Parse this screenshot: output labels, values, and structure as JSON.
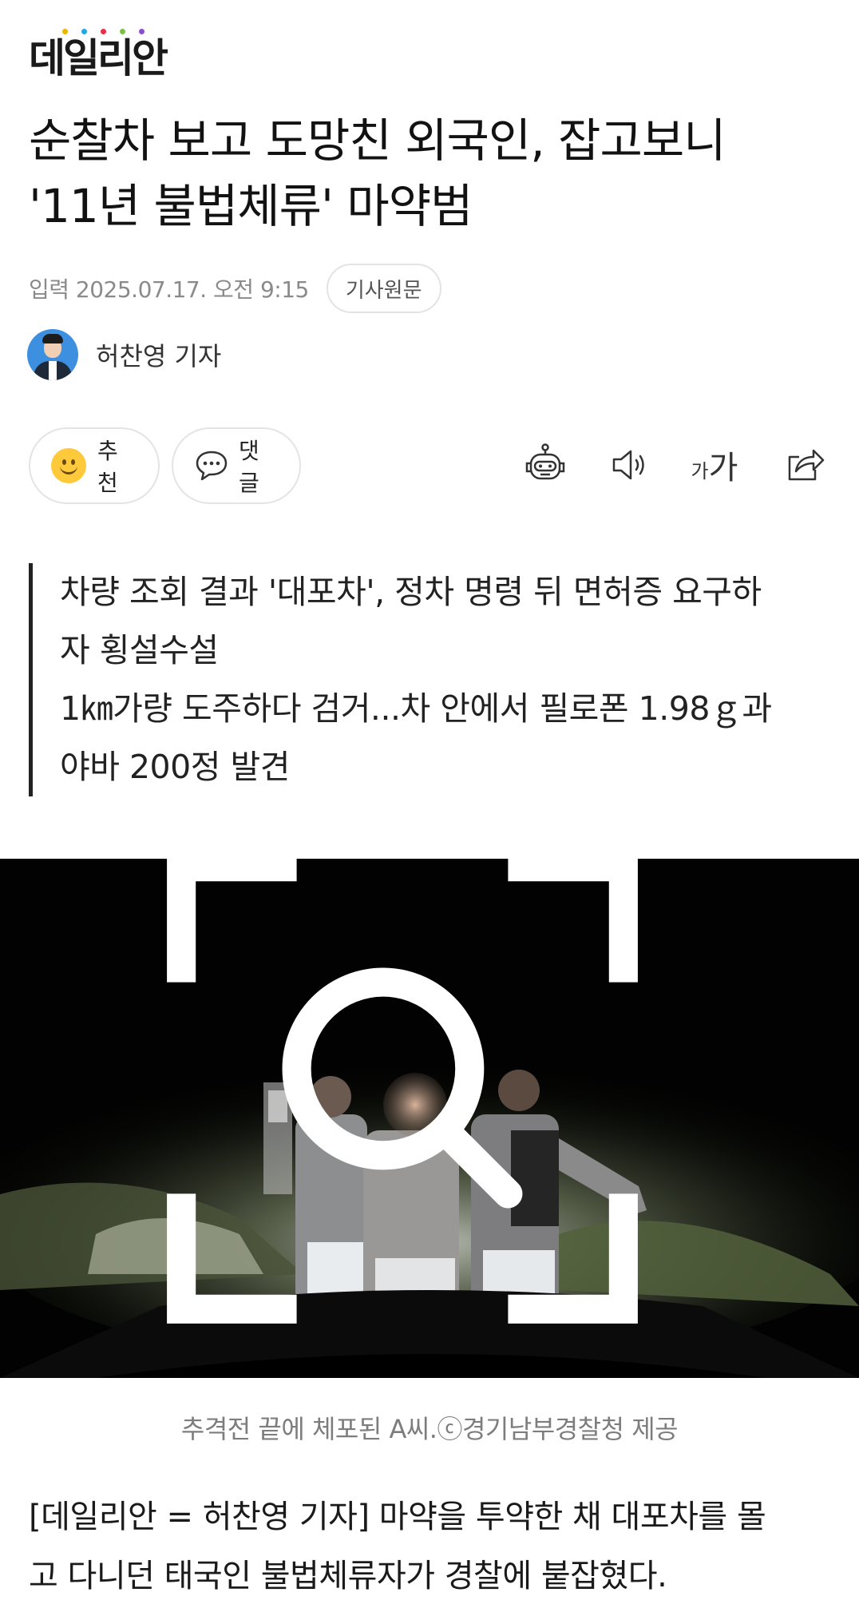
{
  "brand": {
    "logo_text": "데일리안",
    "dot_colors": [
      "#f0b400",
      "#22a6e8",
      "#e6304a",
      "#7ac143",
      "#8a4fd1"
    ]
  },
  "article": {
    "title_line1": "순찰차 보고 도망친 외국인, 잡고보니",
    "title_line2": "'11년 불법체류' 마약범",
    "date": "입력 2025.07.17. 오전 9:15",
    "original_link": "기사원문",
    "reporter": "허찬영 기자"
  },
  "actions": {
    "recommend_label": "추천",
    "comment_label": "댓글",
    "font_small": "가",
    "font_large": "가",
    "icons": [
      "robot-summary-icon",
      "speaker-icon",
      "font-size-icon",
      "share-icon"
    ]
  },
  "summary": {
    "line1": "차량 조회 결과 '대포차', 정차 명령 뒤 면허증 요구하",
    "line2": "자 횡설수설",
    "line3": "1㎞가량 도주하다 검거...차 안에서 필로폰 1.98ｇ과",
    "line4": "야바 200정 발견"
  },
  "photo": {
    "caption": "추격전 끝에 체포된 A씨.ⓒ경기남부경찰청 제공",
    "zoom_icon": "zoom-search-icon"
  },
  "body": {
    "line1": "[데일리안 = 허찬영 기자] 마약을 투약한 채 대포차를 몰",
    "line2": "고 다니던 태국인 불법체류자가 경찰에 붙잡혔다."
  }
}
